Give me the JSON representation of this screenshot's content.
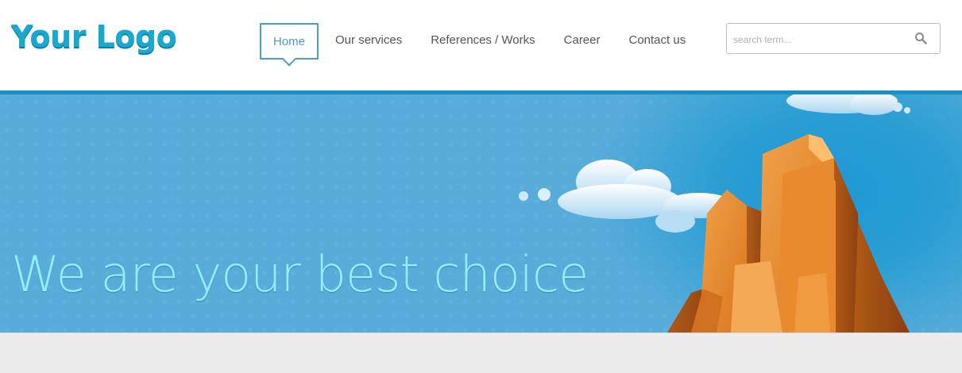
{
  "header": {
    "logo": "Your Logo",
    "nav": [
      {
        "label": "Home",
        "active": true
      },
      {
        "label": "Our services",
        "active": false
      },
      {
        "label": "References / Works",
        "active": false
      },
      {
        "label": "Career",
        "active": false
      },
      {
        "label": "Contact us",
        "active": false
      }
    ],
    "search": {
      "placeholder": "search term...",
      "value": "",
      "icon": "search-icon"
    }
  },
  "hero": {
    "title": "We are your best choice",
    "illustration": [
      "cloud-icon",
      "building-icon"
    ]
  },
  "colors": {
    "accent": "#1a8fc1",
    "logo": "#1ba8cf",
    "hero_bg": "#58acd9",
    "hero_text": "#8fefff",
    "nav_active": "#4a9fc9"
  }
}
